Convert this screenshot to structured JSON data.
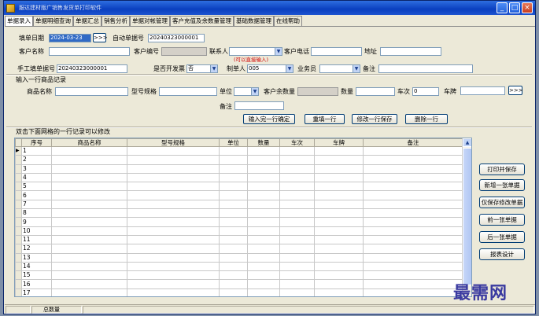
{
  "window": {
    "title": "服达建材版广销售发货单打印软件"
  },
  "tabs": [
    "单据录入",
    "单据明细查询",
    "单据汇总",
    "销售分析",
    "单据对帐管理",
    "客户充值及余数量管理",
    "基础数据管理",
    "在线帮助"
  ],
  "header": {
    "date_label": "填单日期",
    "date_value": "2024-03-23",
    "date_btn": ">>>",
    "auto_no_label": "自动单据号",
    "auto_no_value": "20240323000001",
    "customer_name_label": "客户名称",
    "customer_no_label": "客户编号",
    "contact_label": "联系人",
    "contact_hint": "(可以直接输入)",
    "phone_label": "客户电话",
    "address_label": "地址",
    "manual_no_label": "手工填单据号",
    "manual_no_value": "20240323000001",
    "invoice_label": "是否开发票",
    "invoice_value": "否",
    "maker_label": "制单人",
    "maker_value": "005",
    "salesman_label": "业务员",
    "remark_label": "备注"
  },
  "entry": {
    "section_label": "输入一行商品记录",
    "product_label": "商品名称",
    "model_label": "型号规格",
    "unit_label": "单位",
    "balance_label": "客户余数量",
    "qty_label": "数量",
    "trips_label": "车次",
    "trips_value": "0",
    "plate_label": "车牌",
    "plate_btn": ">>>",
    "note_label": "备注",
    "btn_confirm": "输入完一行确定",
    "btn_refill": "重填一行",
    "btn_save_row": "修改一行保存",
    "btn_delete_row": "删除一行"
  },
  "grid": {
    "section_label": "双击下面网格的一行记录可以修改",
    "columns": [
      "序号",
      "商品名称",
      "型号规格",
      "单位",
      "数量",
      "车次",
      "车牌",
      "备注"
    ],
    "rows": [
      "1",
      "2",
      "3",
      "4",
      "5",
      "6",
      "7",
      "8",
      "9",
      "10",
      "11",
      "12",
      "13",
      "14",
      "15",
      "16",
      "17"
    ]
  },
  "side_buttons": [
    "打印并保存",
    "新增一张单据",
    "仅保存修改单据",
    "前一张单据",
    "后一张单据",
    "报表设计"
  ],
  "status": {
    "total_qty_label": "总数量"
  },
  "watermark": "最需网"
}
